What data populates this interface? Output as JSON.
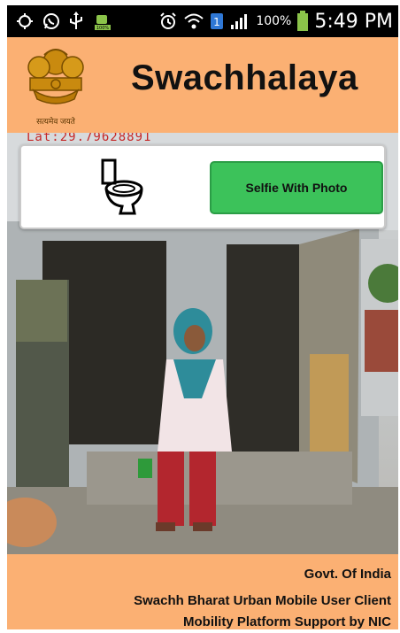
{
  "status_bar": {
    "battery_percent": "100%",
    "time": "5:49 PM",
    "sim_number": "1",
    "icons": [
      "location-icon",
      "whatsapp-icon",
      "usb-icon",
      "android-icon",
      "alarm-icon",
      "wifi-icon",
      "signal-icon",
      "battery-icon"
    ]
  },
  "header": {
    "app_title": "Swachhalaya",
    "emblem_caption": "सत्यमेव जयते"
  },
  "photo": {
    "lat_text": "Lat:29.79628891"
  },
  "action_card": {
    "icon": "toilet-icon",
    "button_label": "Selfie With Photo",
    "button_color": "#3cc25a"
  },
  "footer": {
    "line1": "Govt. Of India",
    "line2": "Swachh Bharat Urban Mobile User Client",
    "line3": "Mobility Platform Support by NIC"
  },
  "colors": {
    "header_bg": "#fbb073",
    "footer_bg": "#fbb073",
    "status_bg": "#000000"
  }
}
